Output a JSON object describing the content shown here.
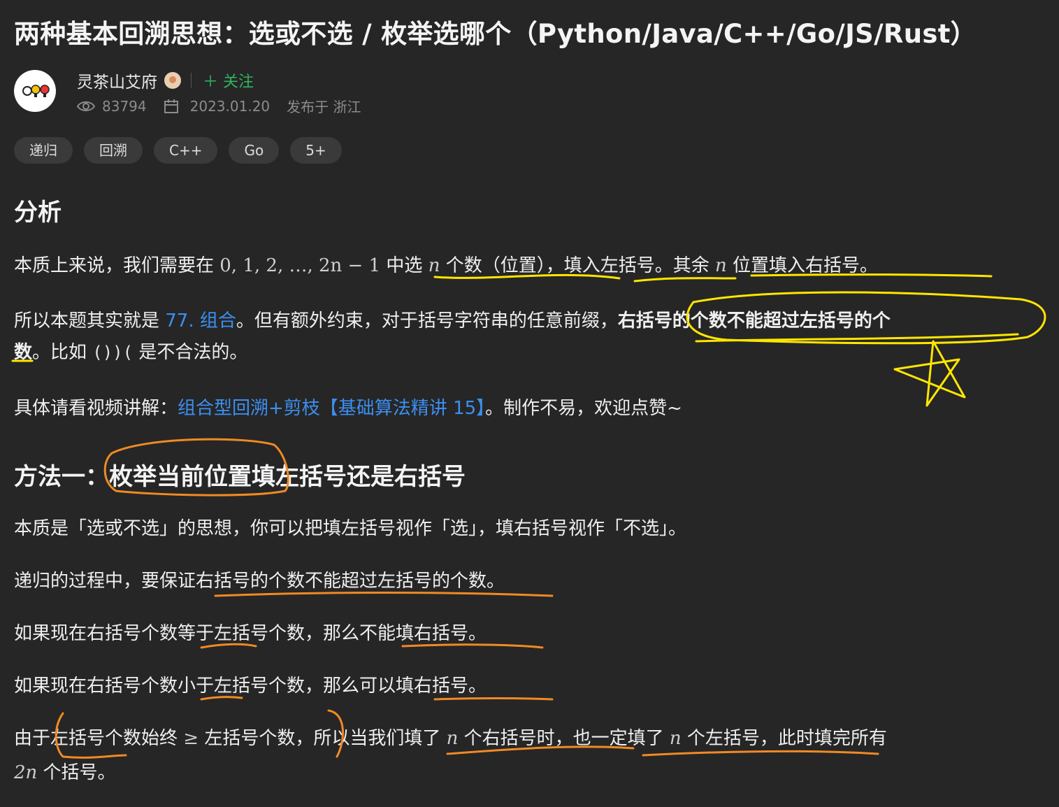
{
  "title": "两种基本回溯思想：选或不选 / 枚举选哪个（Python/Java/C++/Go/JS/Rust）",
  "author": {
    "name": "灵茶山艾府",
    "follow": "＋ 关注",
    "views": "83794",
    "date": "2023.01.20",
    "location": "发布于 浙江"
  },
  "tags": [
    "递归",
    "回溯",
    "C++",
    "Go",
    "5+"
  ],
  "section1": {
    "heading": "分析",
    "p1": {
      "a": "本质上来说，我们需要在 ",
      "math1": "0, 1, 2, …, 2n − 1",
      "b": " 中选 ",
      "n1": "n",
      "c": " 个数（位置），填入左括号。其余 ",
      "n2": "n",
      "d": " 位置填入右括号。"
    },
    "p2": {
      "a": "所以本题其实就是 ",
      "link": "77. 组合",
      "b": "。但有额外约束，对于括号字符串的任意前缀，",
      "bold": "右括号的个数不能超过左括号的个",
      "bold2": "数",
      "c": "。比如 ",
      "code": "())(",
      "d": " 是不合法的。"
    },
    "p3": {
      "a": "具体请看视频讲解：",
      "link": "组合型回溯+剪枝【基础算法精讲 15】",
      "b": "。制作不易，欢迎点赞~"
    }
  },
  "section2": {
    "heading": "方法一：枚举当前位置填左括号还是右括号",
    "p1": "本质是「选或不选」的思想，你可以把填左括号视作「选」，填右括号视作「不选」。",
    "p2": "递归的过程中，要保证右括号的个数不能超过左括号的个数。",
    "p3": "如果现在右括号个数等于左括号个数，那么不能填右括号。",
    "p4": "如果现在右括号个数小于左括号个数，那么可以填右括号。",
    "p5": {
      "a": "由于左括号个数始终 ",
      "ge": "≥",
      "b": " 左括号个数，所以当我们填了 ",
      "n1": "n",
      "c": " 个右括号时，也一定填了 ",
      "n2": "n",
      "d": " 个左括号，此时填完所有",
      "two_n": "2n",
      "e": " 个括号。"
    }
  },
  "colors": {
    "background": "#262626",
    "link": "#3b8ff2",
    "follow": "#2db55d",
    "highlight_yellow": "#ffe600",
    "highlight_orange": "#f08a24"
  }
}
